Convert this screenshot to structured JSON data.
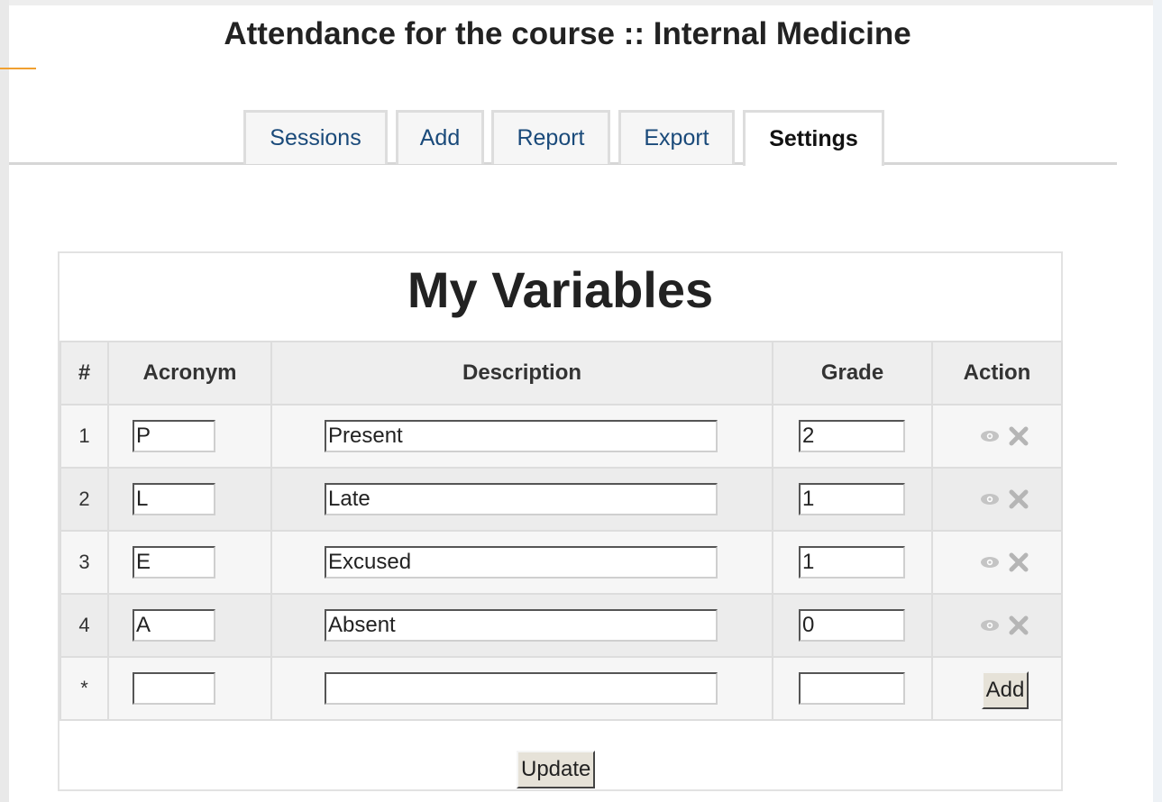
{
  "page": {
    "title": "Attendance for the course :: Internal Medicine"
  },
  "tabs": [
    {
      "label": "Sessions",
      "active": false
    },
    {
      "label": "Add",
      "active": false
    },
    {
      "label": "Report",
      "active": false
    },
    {
      "label": "Export",
      "active": false
    },
    {
      "label": "Settings",
      "active": true
    }
  ],
  "panel": {
    "title": "My Variables",
    "headers": {
      "num": "#",
      "acronym": "Acronym",
      "description": "Description",
      "grade": "Grade",
      "action": "Action"
    },
    "rows": [
      {
        "num": "1",
        "acronym": "P",
        "description": "Present",
        "grade": "2"
      },
      {
        "num": "2",
        "acronym": "L",
        "description": "Late",
        "grade": "1"
      },
      {
        "num": "3",
        "acronym": "E",
        "description": "Excused",
        "grade": "1"
      },
      {
        "num": "4",
        "acronym": "A",
        "description": "Absent",
        "grade": "0"
      }
    ],
    "new_row": {
      "num": "*",
      "acronym": "",
      "description": "",
      "grade": "",
      "add_label": "Add"
    },
    "update_label": "Update",
    "row_action_icons": [
      "eye-icon",
      "close-icon"
    ]
  },
  "colors": {
    "tab_text": "#1a4a7a",
    "active_tab_text": "#111111",
    "header_bg": "#eeeeee",
    "border": "#dddddd",
    "button_bg": "#e6e2d8",
    "accent": "#f0a030"
  }
}
